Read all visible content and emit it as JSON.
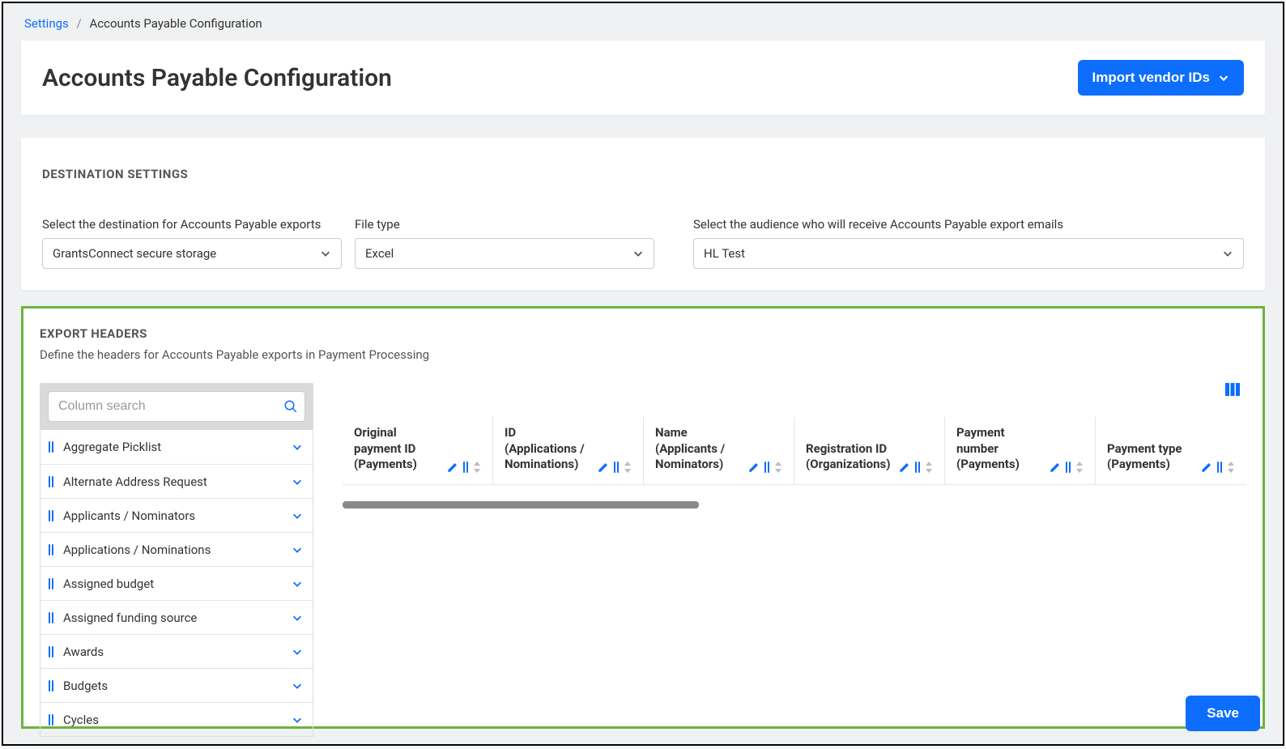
{
  "breadcrumb": {
    "root": "Settings",
    "current": "Accounts Payable Configuration"
  },
  "header": {
    "title": "Accounts Payable Configuration",
    "import_button": "Import vendor IDs"
  },
  "destination": {
    "section_label": "DESTINATION SETTINGS",
    "dest_label": "Select the destination for Accounts Payable exports",
    "dest_value": "GrantsConnect secure storage",
    "filetype_label": "File type",
    "filetype_value": "Excel",
    "audience_label": "Select the audience who will receive Accounts Payable export emails",
    "audience_value": "HL Test"
  },
  "export": {
    "section_label": "EXPORT HEADERS",
    "subtitle": "Define the headers for Accounts Payable exports in Payment Processing",
    "search_placeholder": "Column search",
    "categories": [
      "Aggregate Picklist",
      "Alternate Address Request",
      "Applicants / Nominators",
      "Applications / Nominations",
      "Assigned budget",
      "Assigned funding source",
      "Awards",
      "Budgets",
      "Cycles"
    ],
    "headers": [
      {
        "title": "Original payment ID (Payments)"
      },
      {
        "title": "ID (Applications / Nominations)"
      },
      {
        "title": "Name (Applicants / Nominators)"
      },
      {
        "title": "Registration ID (Organizations)"
      },
      {
        "title": "Payment number (Payments)"
      },
      {
        "title": "Payment type (Payments)"
      }
    ]
  },
  "footer": {
    "save": "Save"
  }
}
